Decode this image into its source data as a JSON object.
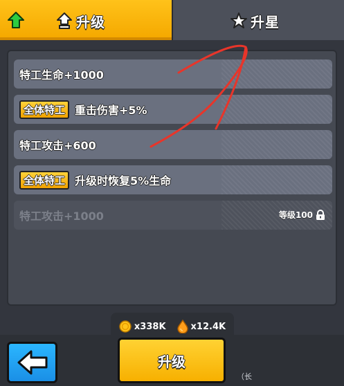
{
  "tabs": {
    "upgrade_label": "升级",
    "star_label": "升星"
  },
  "rows": [
    {
      "tag": "",
      "text": "特工生命+1000",
      "locked": false
    },
    {
      "tag": "全体特工",
      "text": "重击伤害+5%",
      "locked": false
    },
    {
      "tag": "",
      "text": "特工攻击+600",
      "locked": false
    },
    {
      "tag": "全体特工",
      "text": "升级时恢复5%生命",
      "locked": false
    },
    {
      "tag": "",
      "text": "特工攻击+1000",
      "locked": true,
      "lock_text": "等级100"
    }
  ],
  "currency": {
    "coins": "x338K",
    "oil": "x12.4K"
  },
  "buttons": {
    "upgrade": "升级"
  },
  "hint": "（长",
  "colors": {
    "accent": "#f5a900",
    "panel": "#454952",
    "row": "#6a707f",
    "back": "#1a8fe6",
    "annotation": "#e8352a"
  },
  "icons": {
    "tab_badge": "green-up-arrow-icon",
    "upgrade_tab": "upgrade-arrow-icon",
    "star_tab": "star-icon",
    "lock": "lock-icon",
    "coin": "coin-icon",
    "oil": "oil-drop-icon",
    "back": "back-arrow-icon"
  }
}
